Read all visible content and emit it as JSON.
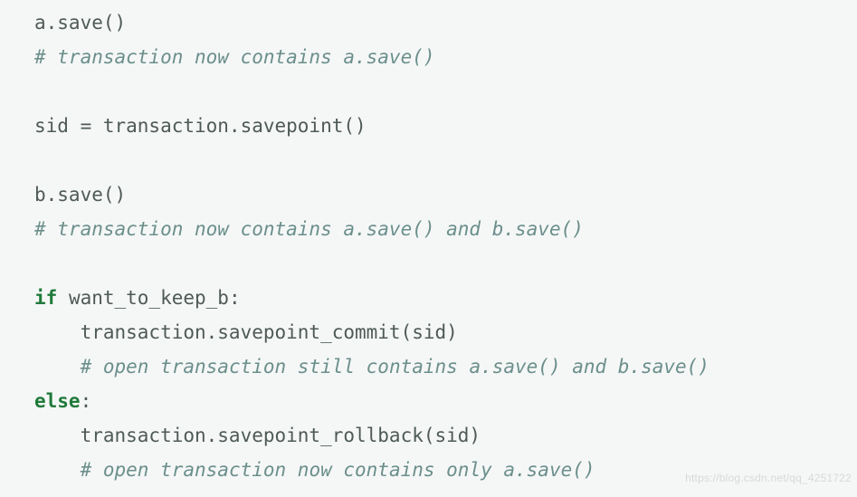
{
  "code": {
    "lines": [
      [
        {
          "cls": "tok-default",
          "t": "a.save()"
        }
      ],
      [
        {
          "cls": "tok-comment",
          "t": "# transaction now contains a.save()"
        }
      ],
      [
        {
          "cls": "tok-default",
          "t": ""
        }
      ],
      [
        {
          "cls": "tok-default",
          "t": "sid = transaction.savepoint()"
        }
      ],
      [
        {
          "cls": "tok-default",
          "t": ""
        }
      ],
      [
        {
          "cls": "tok-default",
          "t": "b.save()"
        }
      ],
      [
        {
          "cls": "tok-comment",
          "t": "# transaction now contains a.save() and b.save()"
        }
      ],
      [
        {
          "cls": "tok-default",
          "t": ""
        }
      ],
      [
        {
          "cls": "tok-keyword",
          "t": "if"
        },
        {
          "cls": "tok-default",
          "t": " want_to_keep_b:"
        }
      ],
      [
        {
          "cls": "tok-default",
          "t": "    transaction.savepoint_commit(sid)"
        }
      ],
      [
        {
          "cls": "tok-default",
          "t": "    "
        },
        {
          "cls": "tok-comment",
          "t": "# open transaction still contains a.save() and b.save()"
        }
      ],
      [
        {
          "cls": "tok-keyword",
          "t": "else"
        },
        {
          "cls": "tok-default",
          "t": ":"
        }
      ],
      [
        {
          "cls": "tok-default",
          "t": "    transaction.savepoint_rollback(sid)"
        }
      ],
      [
        {
          "cls": "tok-default",
          "t": "    "
        },
        {
          "cls": "tok-comment",
          "t": "# open transaction now contains only a.save()"
        }
      ]
    ]
  },
  "watermark": "https://blog.csdn.net/qq_4251722"
}
